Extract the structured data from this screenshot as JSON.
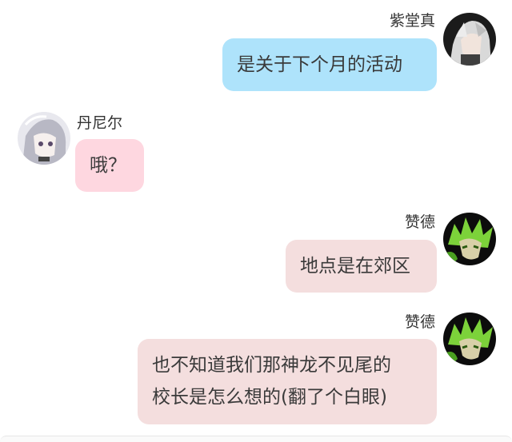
{
  "messages": [
    {
      "sender": "紫堂真",
      "side": "right",
      "bubble_color": "#aee3fb",
      "lines": [
        "是关于下个月的活动"
      ],
      "avatar": "avatar-silver-hair-character"
    },
    {
      "sender": "丹尼尔",
      "side": "left",
      "bubble_color": "#fed7e0",
      "lines": [
        "哦？"
      ],
      "avatar": "avatar-white-hair-character"
    },
    {
      "sender": "赞德",
      "side": "right",
      "bubble_color": "#f4dede",
      "lines": [
        "地点是在郊区"
      ],
      "avatar": "avatar-green-hair-character"
    },
    {
      "sender": "赞德",
      "side": "right",
      "bubble_color": "#f4dede",
      "lines": [
        "也不知道我们那神龙不见尾的",
        "校长是怎么想的(翻了个白眼)"
      ],
      "avatar": "avatar-green-hair-character"
    }
  ]
}
